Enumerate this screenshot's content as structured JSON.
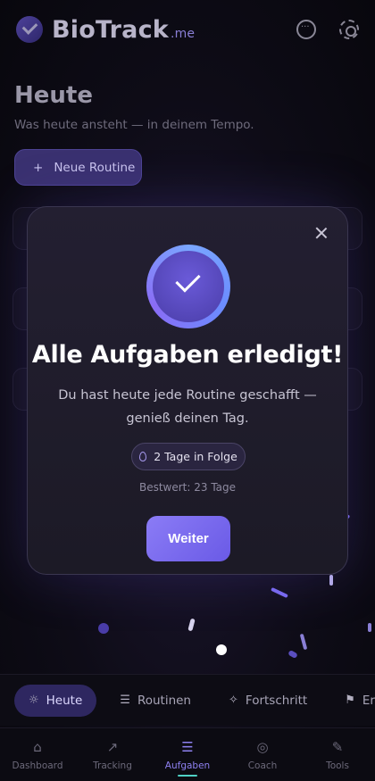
{
  "header": {
    "brand": "BioTrack",
    "brand_tld": ".me"
  },
  "page": {
    "title": "Heute",
    "subtitle": "Was heute ansteht — in deinem Tempo.",
    "new_routine_label": "Neue Routine",
    "new_routine_icon": "+"
  },
  "modal": {
    "title": "Alle Aufgaben erledigt!",
    "text": "Du hast heute jede Routine geschafft — genieß deinen Tag.",
    "streak": "2 Tage in Folge",
    "best": "Bestwert: 23 Tage",
    "continue_label": "Weiter"
  },
  "tabs": [
    {
      "label": "Heute",
      "icon": "☼"
    },
    {
      "label": "Routinen",
      "icon": "☰"
    },
    {
      "label": "Fortschritt",
      "icon": "✧"
    },
    {
      "label": "Er",
      "icon": "⚑"
    }
  ],
  "nav": [
    {
      "label": "Dashboard",
      "icon": "⌂"
    },
    {
      "label": "Tracking",
      "icon": "↗"
    },
    {
      "label": "Aufgaben",
      "icon": "☰"
    },
    {
      "label": "Coach",
      "icon": "◎"
    },
    {
      "label": "Tools",
      "icon": "✎"
    }
  ],
  "colors": {
    "accent": "#7b6cf2",
    "teal": "#4fd1c5"
  }
}
